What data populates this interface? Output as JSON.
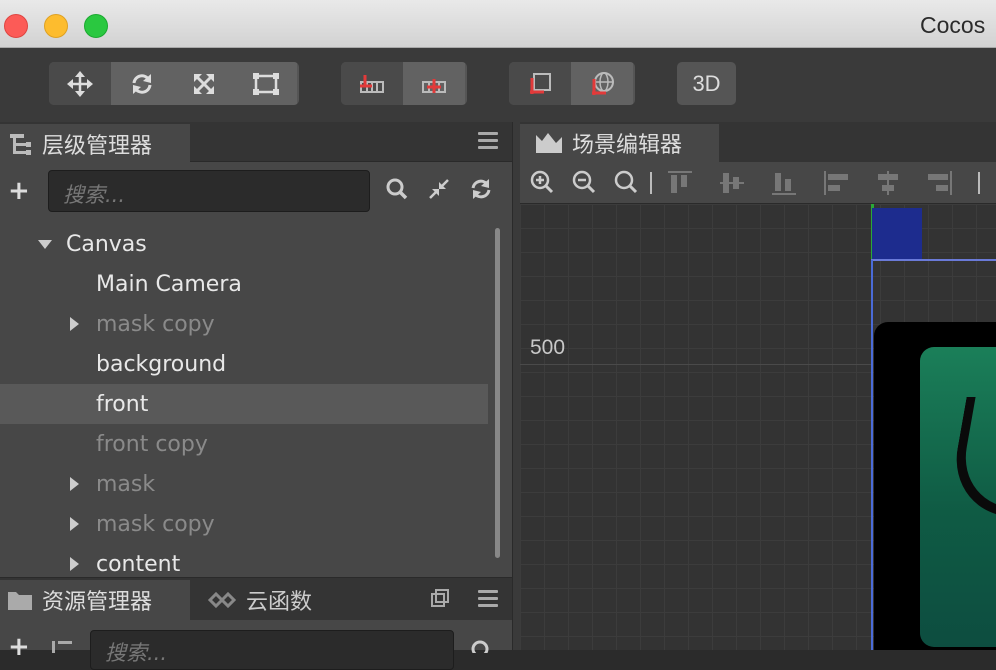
{
  "window": {
    "title": "Cocos"
  },
  "toolbar": {
    "button_3d_label": "3D"
  },
  "hierarchy": {
    "tab_label": "层级管理器",
    "search_placeholder": "搜索...",
    "nodes": [
      {
        "label": "Canvas",
        "expanded": true
      },
      {
        "label": "Main Camera"
      },
      {
        "label": "mask copy",
        "collapsed": true,
        "inactive": true
      },
      {
        "label": "background"
      },
      {
        "label": "front",
        "selected": true
      },
      {
        "label": "front copy",
        "inactive": true
      },
      {
        "label": "mask",
        "collapsed": true,
        "inactive": true
      },
      {
        "label": "mask copy",
        "collapsed": true,
        "inactive": true
      },
      {
        "label": "content",
        "collapsed": true
      }
    ]
  },
  "assets": {
    "tab_label": "资源管理器",
    "cloud_tab_label": "云函数",
    "search_placeholder": "搜索..."
  },
  "scene": {
    "tab_label": "场景编辑器",
    "grid_label": "500"
  },
  "colors": {
    "selection": "#595959",
    "canvas_outline": "#4a6bd8",
    "accent_red": "#e23a3a"
  }
}
